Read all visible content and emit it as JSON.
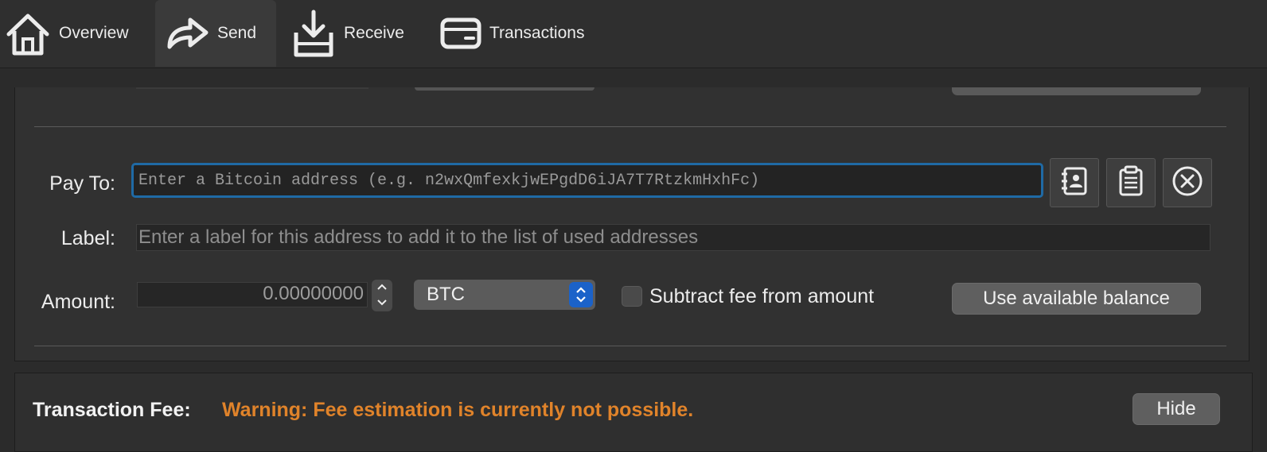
{
  "toolbar": {
    "tabs": [
      {
        "label": "Overview",
        "icon": "home-icon"
      },
      {
        "label": "Send",
        "icon": "send-arrow-icon",
        "active": true
      },
      {
        "label": "Receive",
        "icon": "receive-tray-icon"
      },
      {
        "label": "Transactions",
        "icon": "wallet-card-icon"
      }
    ]
  },
  "payment": {
    "pay_to_label": "Pay To:",
    "pay_to_placeholder": "Enter a Bitcoin address (e.g. n2wxQmfexkjwEPgdD6iJA7T7RtzkmHxhFc)",
    "label_label": "Label:",
    "label_placeholder": "Enter a label for this address to add it to the list of used addresses",
    "amount_label": "Amount:",
    "amount_value": "0.00000000",
    "unit": "BTC",
    "subtract_fee_label": "Subtract fee from amount",
    "subtract_fee_checked": false,
    "use_balance_label": "Use available balance",
    "buttons": [
      "address-book-icon",
      "clipboard-icon",
      "remove-circle-icon"
    ]
  },
  "fee": {
    "title": "Transaction Fee:",
    "warning": "Warning: Fee estimation is currently not possible.",
    "warning_color": "#e0832a",
    "hide_label": "Hide"
  },
  "colors": {
    "focus_ring": "#1f6aa5",
    "select_accent": "#1b62c9"
  }
}
